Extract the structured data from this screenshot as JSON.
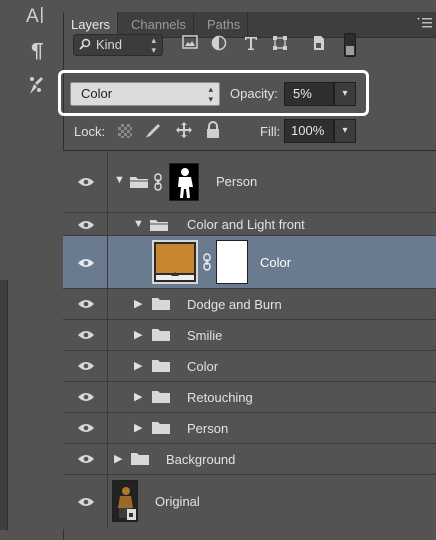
{
  "toolbar": {
    "tools": [
      {
        "icon": "character-panel-icon",
        "glyph": "A|"
      },
      {
        "icon": "paragraph-panel-icon",
        "glyph": "¶"
      },
      {
        "icon": "tool-presets-icon",
        "glyph": "⚲"
      }
    ]
  },
  "tabs": [
    {
      "label": "Layers",
      "active": true
    },
    {
      "label": "Channels",
      "active": false
    },
    {
      "label": "Paths",
      "active": false
    }
  ],
  "filter": {
    "kind_label": "Kind",
    "icons": [
      "pixel-layer-filter-icon",
      "adjustment-layer-filter-icon",
      "type-layer-filter-icon",
      "shape-layer-filter-icon",
      "smart-object-filter-icon"
    ]
  },
  "blend": {
    "mode": "Color",
    "opacity_label": "Opacity:",
    "opacity_value": "5%"
  },
  "lock": {
    "label": "Lock:",
    "fill_label": "Fill:",
    "fill_value": "100%"
  },
  "layers": [
    {
      "name": "Person",
      "type": "group-mask",
      "expanded": true,
      "indent": 0
    },
    {
      "name": "Color and Light front",
      "type": "group",
      "expanded": true,
      "indent": 1
    },
    {
      "name": "Color",
      "type": "fill-mask",
      "selected": true,
      "indent": 2,
      "fill_color": "#c8862f"
    },
    {
      "name": "Dodge and Burn",
      "type": "group",
      "expanded": false,
      "indent": 1
    },
    {
      "name": "Smilie",
      "type": "group",
      "expanded": false,
      "indent": 1
    },
    {
      "name": "Color",
      "type": "group",
      "expanded": false,
      "indent": 1
    },
    {
      "name": "Retouching",
      "type": "group",
      "expanded": false,
      "indent": 1
    },
    {
      "name": "Person",
      "type": "group",
      "expanded": false,
      "indent": 1
    },
    {
      "name": "Background",
      "type": "group",
      "expanded": false,
      "indent": 0
    },
    {
      "name": "Original",
      "type": "smart-object",
      "indent": 0
    }
  ],
  "colors": {
    "panel_bg": "#535353",
    "selected_row": "#6a7b8f",
    "highlight_border": "#ffffff",
    "color_fill": "#c8862f"
  }
}
